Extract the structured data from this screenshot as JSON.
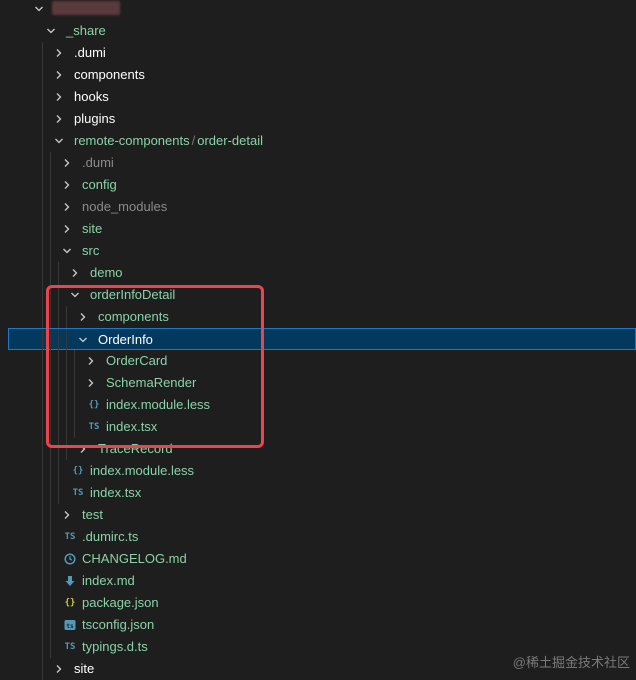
{
  "explorer": {
    "items": [
      {
        "label": "_share",
        "depth": 0,
        "kind": "folder",
        "open": true,
        "color": "green"
      },
      {
        "label": ".dumi",
        "depth": 1,
        "kind": "folder",
        "open": false,
        "color": "white"
      },
      {
        "label": "components",
        "depth": 1,
        "kind": "folder",
        "open": false,
        "color": "white"
      },
      {
        "label": "hooks",
        "depth": 1,
        "kind": "folder",
        "open": false,
        "color": "white"
      },
      {
        "label": "plugins",
        "depth": 1,
        "kind": "folder",
        "open": false,
        "color": "white"
      },
      {
        "label": "remote-components",
        "label_suffix": "order-detail",
        "depth": 1,
        "kind": "folder",
        "open": true,
        "color": "green"
      },
      {
        "label": ".dumi",
        "depth": 2,
        "kind": "folder",
        "open": false,
        "color": "dim"
      },
      {
        "label": "config",
        "depth": 2,
        "kind": "folder",
        "open": false,
        "color": "green"
      },
      {
        "label": "node_modules",
        "depth": 2,
        "kind": "folder",
        "open": false,
        "color": "dim"
      },
      {
        "label": "site",
        "depth": 2,
        "kind": "folder",
        "open": false,
        "color": "green"
      },
      {
        "label": "src",
        "depth": 2,
        "kind": "folder",
        "open": true,
        "color": "green"
      },
      {
        "label": "demo",
        "depth": 3,
        "kind": "folder",
        "open": false,
        "color": "green"
      },
      {
        "label": "orderInfoDetail",
        "depth": 3,
        "kind": "folder",
        "open": true,
        "color": "green"
      },
      {
        "label": "components",
        "depth": 4,
        "kind": "folder",
        "open": false,
        "color": "green"
      },
      {
        "label": "OrderInfo",
        "depth": 4,
        "kind": "folder",
        "open": true,
        "color": "white",
        "selected": true
      },
      {
        "label": "OrderCard",
        "depth": 5,
        "kind": "folder",
        "open": false,
        "color": "green"
      },
      {
        "label": "SchemaRender",
        "depth": 5,
        "kind": "folder",
        "open": false,
        "color": "green"
      },
      {
        "label": "index.module.less",
        "depth": 5,
        "kind": "file",
        "icon": "less",
        "color": "green"
      },
      {
        "label": "index.tsx",
        "depth": 5,
        "kind": "file",
        "icon": "ts",
        "color": "green"
      },
      {
        "label": "TraceRecord",
        "depth": 4,
        "kind": "folder",
        "open": false,
        "color": "green"
      },
      {
        "label": "index.module.less",
        "depth": 3,
        "kind": "file",
        "icon": "less",
        "color": "green"
      },
      {
        "label": "index.tsx",
        "depth": 3,
        "kind": "file",
        "icon": "ts",
        "color": "green"
      },
      {
        "label": "test",
        "depth": 2,
        "kind": "folder",
        "open": false,
        "color": "green"
      },
      {
        "label": ".dumirc.ts",
        "depth": 2,
        "kind": "file",
        "icon": "ts",
        "color": "green"
      },
      {
        "label": "CHANGELOG.md",
        "depth": 2,
        "kind": "file",
        "icon": "clock",
        "color": "green"
      },
      {
        "label": "index.md",
        "depth": 2,
        "kind": "file",
        "icon": "download",
        "color": "green"
      },
      {
        "label": "package.json",
        "depth": 2,
        "kind": "file",
        "icon": "json",
        "color": "green"
      },
      {
        "label": "tsconfig.json",
        "depth": 2,
        "kind": "file",
        "icon": "tsconfig",
        "color": "green"
      },
      {
        "label": "typings.d.ts",
        "depth": 2,
        "kind": "file",
        "icon": "ts",
        "color": "green"
      },
      {
        "label": "site",
        "depth": 1,
        "kind": "folder",
        "open": false,
        "color": "white"
      }
    ]
  },
  "icons": {
    "ts": "TS",
    "json": "{}",
    "less": "{}"
  },
  "colors": {
    "green": "#8ad3a8",
    "white": "#ffffff",
    "dim": "#8b8b8b",
    "selection": "#04395e",
    "selection_border": "#1c79c7",
    "highlight_box": "#e8454f",
    "ts_icon": "#519aba",
    "json_icon": "#cbcb41",
    "less_icon": "#519aba",
    "md_icon": "#519aba"
  },
  "watermark": "@稀土掘金技术社区"
}
